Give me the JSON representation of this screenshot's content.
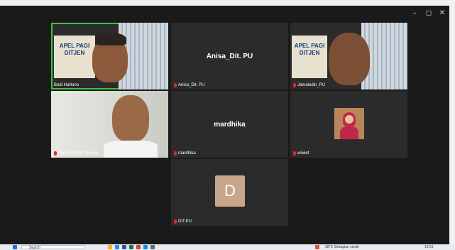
{
  "window": {
    "minimize_glyph": "–",
    "maximize_glyph": "◻",
    "close_glyph": "✕"
  },
  "participants": [
    {
      "name": "Budi Hartono",
      "banner_line1": "APEL PAGI",
      "banner_line2": "DITJEN",
      "video": true
    },
    {
      "name": "Anisa_Dit. PU",
      "center_label": "Anisa_Dit. PU",
      "video": false
    },
    {
      "name": "Jamaludin_PU",
      "banner_line1": "APEL PAGI",
      "banner_line2": "DITJEN",
      "video": true
    },
    {
      "name": "Yudi / PSDKP Benoa",
      "video": true
    },
    {
      "name": "mardhika",
      "center_label": "mardhika",
      "video": false
    },
    {
      "name": "wiwiet",
      "video": true
    },
    {
      "name": "DIT.PU",
      "avatar_letter": "D",
      "video": false
    }
  ],
  "taskbar": {
    "search_label": "Search",
    "weather": "28°C  Sebagian cerah",
    "time": "19:51"
  },
  "colors": {
    "active_speaker": "#3fc23a",
    "muted_mic": "#e02828",
    "avatar_tile": "#c9a58a"
  }
}
